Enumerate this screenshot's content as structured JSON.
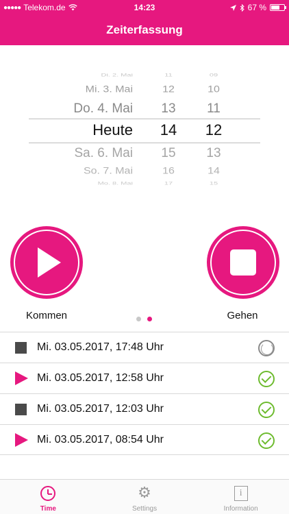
{
  "status_bar": {
    "carrier": "Telekom.de",
    "signal_dots": "●●●●●",
    "time": "14:23",
    "battery": "67 %",
    "battery_level": 0.67,
    "icons": [
      "wifi-icon",
      "location-icon",
      "bluetooth-icon",
      "battery-icon"
    ]
  },
  "header": {
    "title": "Zeiterfassung",
    "color": "#e6187f"
  },
  "picker": {
    "days": [
      "Di. 2. Mai",
      "Mi. 3. Mai",
      "Do. 4. Mai",
      "Heute",
      "Sa. 6. Mai",
      "So. 7. Mai",
      "Mo. 8. Mai"
    ],
    "hours": [
      "11",
      "12",
      "13",
      "14",
      "15",
      "16",
      "17"
    ],
    "minutes": [
      "09",
      "10",
      "11",
      "12",
      "13",
      "14",
      "15"
    ],
    "selected": {
      "day": "Heute",
      "hour": "14",
      "minute": "12"
    }
  },
  "actions": {
    "come": {
      "label": "Kommen",
      "icon": "play-icon"
    },
    "go": {
      "label": "Gehen",
      "icon": "stop-icon"
    },
    "pager": {
      "pages": 2,
      "active": 2
    }
  },
  "entries": [
    {
      "type": "gehen",
      "icon": "stop-icon",
      "text": "Mi. 03.05.2017, 17:48 Uhr",
      "status": "pending"
    },
    {
      "type": "kommen",
      "icon": "play-icon",
      "text": "Mi. 03.05.2017, 12:58 Uhr",
      "status": "done"
    },
    {
      "type": "gehen",
      "icon": "stop-icon",
      "text": "Mi. 03.05.2017, 12:03 Uhr",
      "status": "done"
    },
    {
      "type": "kommen",
      "icon": "play-icon",
      "text": "Mi. 03.05.2017, 08:54 Uhr",
      "status": "done"
    }
  ],
  "tabs": [
    {
      "label": "Time",
      "icon": "clock-icon",
      "active": true
    },
    {
      "label": "Settings",
      "icon": "gear-icon",
      "active": false
    },
    {
      "label": "Information",
      "icon": "info-icon",
      "active": false
    }
  ],
  "colors": {
    "accent": "#e6187f",
    "done": "#6dbb2e",
    "stop": "#4a4a4a"
  }
}
